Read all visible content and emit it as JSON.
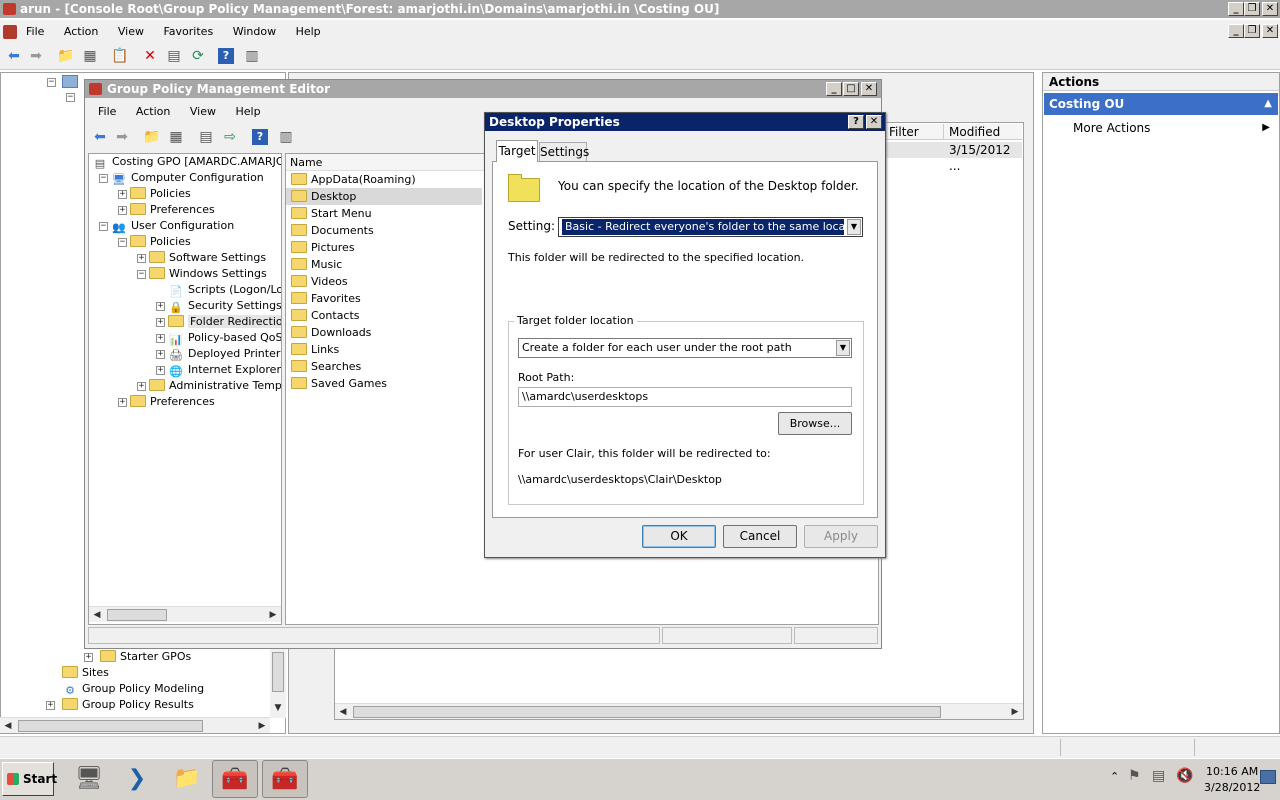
{
  "mmc": {
    "title": "arun - [Console Root\\Group Policy Management\\Forest: amarjothi.in\\Domains\\amarjothi.in \\Costing OU]",
    "menu": [
      "File",
      "Action",
      "View",
      "Favorites",
      "Window",
      "Help"
    ],
    "tree_bottom": {
      "starter_gpos": "Starter GPOs",
      "sites": "Sites",
      "modeling": "Group Policy Modeling",
      "results": "Group Policy Results"
    },
    "list_columns": {
      "filter": "Filter",
      "modified": "Modified"
    },
    "list_row_modified": "3/15/2012 ...",
    "actions": {
      "header": "Actions",
      "section": "Costing OU",
      "more": "More Actions"
    }
  },
  "gpme": {
    "title": "Group Policy Management Editor",
    "menu": [
      "File",
      "Action",
      "View",
      "Help"
    ],
    "tree": [
      {
        "label": "Costing GPO [AMARDC.AMARJOTH",
        "level": 0,
        "exp": "",
        "icon": "gpo-icon"
      },
      {
        "label": "Computer Configuration",
        "level": 0,
        "exp": "−",
        "icon": "computer-icon"
      },
      {
        "label": "Policies",
        "level": 1,
        "exp": "+",
        "icon": "folder-icon"
      },
      {
        "label": "Preferences",
        "level": 1,
        "exp": "+",
        "icon": "folder-icon"
      },
      {
        "label": "User Configuration",
        "level": 0,
        "exp": "−",
        "icon": "users-icon"
      },
      {
        "label": "Policies",
        "level": 1,
        "exp": "−",
        "icon": "folder-icon"
      },
      {
        "label": "Software Settings",
        "level": 2,
        "exp": "+",
        "icon": "folder-icon"
      },
      {
        "label": "Windows Settings",
        "level": 2,
        "exp": "−",
        "icon": "folder-icon"
      },
      {
        "label": "Scripts (Logon/Logo",
        "level": 3,
        "exp": "",
        "icon": "script-icon"
      },
      {
        "label": "Security Settings",
        "level": 3,
        "exp": "+",
        "icon": "security-icon"
      },
      {
        "label": "Folder Redirection",
        "level": 3,
        "exp": "+",
        "icon": "folder-open-icon",
        "selected": true
      },
      {
        "label": "Policy-based QoS",
        "level": 3,
        "exp": "+",
        "icon": "chart-icon"
      },
      {
        "label": "Deployed Printers",
        "level": 3,
        "exp": "+",
        "icon": "printer-icon"
      },
      {
        "label": "Internet Explorer M",
        "level": 3,
        "exp": "+",
        "icon": "ie-icon"
      },
      {
        "label": "Administrative Templat",
        "level": 2,
        "exp": "+",
        "icon": "folder-icon"
      },
      {
        "label": "Preferences",
        "level": 1,
        "exp": "+",
        "icon": "folder-icon"
      }
    ],
    "list_header": "Name",
    "list_items": [
      "AppData(Roaming)",
      "Desktop",
      "Start Menu",
      "Documents",
      "Pictures",
      "Music",
      "Videos",
      "Favorites",
      "Contacts",
      "Downloads",
      "Links",
      "Searches",
      "Saved Games"
    ]
  },
  "dialog": {
    "title": "Desktop Properties",
    "help_glyph": "?",
    "close_glyph": "✕",
    "tabs": [
      "Target",
      "Settings"
    ],
    "intro": "You can specify the location of the Desktop folder.",
    "setting_label": "Setting:",
    "setting_value": "Basic - Redirect everyone's folder to the same location",
    "redirect_note": "This folder will be redirected to the specified location.",
    "group_label": "Target folder location",
    "target_value": "Create a folder for each user under the root path",
    "root_label": "Root Path:",
    "root_value": "\\\\amardc\\userdesktops",
    "browse": "Browse...",
    "example_label": "For user Clair, this folder will be redirected to:",
    "example_path": "\\\\amardc\\userdesktops\\Clair\\Desktop",
    "ok": "OK",
    "cancel": "Cancel",
    "apply": "Apply"
  },
  "taskbar": {
    "start": "Start",
    "time": "10:16 AM",
    "date": "3/28/2012"
  },
  "colors": {
    "active_title": "#0a246a",
    "actions_header": "#3c6fc7",
    "selected_setting": "#0a246a"
  }
}
